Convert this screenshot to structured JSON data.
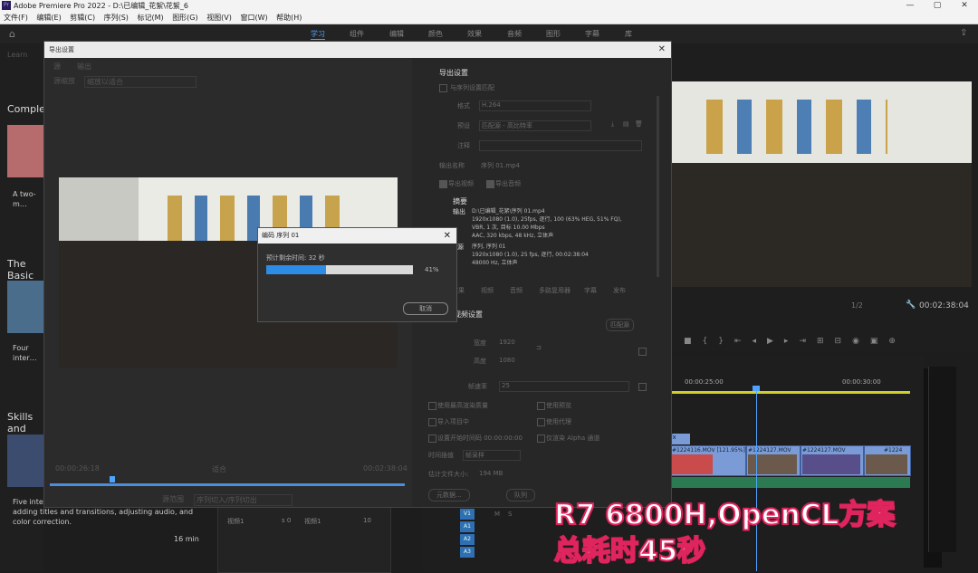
{
  "app": {
    "window_title": "Adobe Premiere Pro 2022 - D:\\已编辑_花絮\\花絮_6",
    "window_controls": [
      "—",
      "▢",
      "✕"
    ]
  },
  "menubar": [
    "文件(F)",
    "编辑(E)",
    "剪辑(C)",
    "序列(S)",
    "标记(M)",
    "图形(G)",
    "视图(V)",
    "窗口(W)",
    "帮助(H)"
  ],
  "workspaces": [
    "学习",
    "组件",
    "编辑",
    "颜色",
    "效果",
    "音频",
    "图形",
    "字幕",
    "库"
  ],
  "active_workspace": "学习",
  "learn_panel": {
    "tab": "Learn",
    "lessons": [
      {
        "title": "Complete",
        "desc": "A two-m… essentials"
      },
      {
        "title": "The Basic",
        "desc": "Four inter… video edi…"
      },
      {
        "title": "Skills and",
        "desc": "Five interactive tutorials… adjusting clip speed, adding titles and transitions, adjusting audio, and color correction.",
        "duration": "16 min"
      }
    ]
  },
  "export_dialog": {
    "title": "导出设置",
    "left_tabs": [
      "源",
      "输出"
    ],
    "source_scaling_label": "源缩放",
    "source_scaling_value": "缩放以适合",
    "timecode_start": "00:00:26:18",
    "timecode_end": "00:02:38:04",
    "fit_label": "适合",
    "source_range_label": "源范围",
    "source_range_value": "序列切入/序列切出",
    "settings": {
      "header": "导出设置",
      "match_sequence": "与序列设置匹配",
      "format_label": "格式",
      "format_value": "H.264",
      "preset_label": "预设",
      "preset_value": "匹配源 - 高比特率",
      "comments_label": "注释",
      "output_name_label": "输出名称",
      "output_name_value": "序列 01.mp4",
      "export_video": "导出视频",
      "export_audio": "导出音频",
      "summary_header": "摘要",
      "output_label": "输出",
      "output_lines": [
        "D:\\已编辑_花絮\\序列 01.mp4",
        "1920x1080 (1.0), 25fps, 逐行, 100 (63% HEG, 51% FQ),",
        "VBR, 1 次, 目标 10.00 Mbps",
        "AAC, 320 kbps, 48 kHz, 立体声"
      ],
      "source_label": "源",
      "source_lines": [
        "序列, 序列 01",
        "1920x1080 (1.0), 25 fps, 逐行, 00:02:38:04",
        "48000 Hz, 立体声"
      ],
      "tabs": [
        "效果",
        "视频",
        "音频",
        "多路复用器",
        "字幕",
        "发布"
      ],
      "video_settings_header": "视频设置",
      "match_source_button": "匹配源",
      "width_label": "宽度",
      "width_value": "1920",
      "height_label": "高度",
      "height_value": "1080",
      "frame_rate_label": "帧速率",
      "frame_rate_value": "25",
      "options": [
        "使用最高渲染质量",
        "使用预览",
        "导入项目中",
        "使用代理",
        "设置开始时间码 00:00:00:00",
        "仅渲染 Alpha 通道"
      ],
      "interpolation_label": "时间插值",
      "interpolation_value": "帧采样",
      "filesize_label": "估计文件大小:",
      "filesize_value": "194 MB",
      "metadata_button": "元数据...",
      "queue_button": "队列"
    }
  },
  "progress_dialog": {
    "title": "编码 序列 01",
    "remaining_text": "预计剩余时间: 32 秒",
    "percent": 41,
    "percent_text": "41%",
    "cancel_label": "取消"
  },
  "right_program": {
    "timecode": "00:02:38:04",
    "zoom": "1/2",
    "fit": "适合"
  },
  "timeline": {
    "ruler_marks": [
      "00:00:25:00",
      "00:00:30:00"
    ],
    "clips": [
      "fx",
      "#1224116.MOV [121.95%]",
      "#1224127.MOV",
      "#1224127.MOV",
      "#1224"
    ],
    "tracks": [
      "V1",
      "A1",
      "A2",
      "A3"
    ],
    "track_controls": [
      "M",
      "S"
    ]
  },
  "small_panel": {
    "items": [
      "视频1",
      "视频1"
    ],
    "s_label": "s 0",
    "n_label": "10"
  },
  "overlay": {
    "line1": "R7 6800H,OpenCL方案",
    "line2": "总耗时45秒"
  }
}
